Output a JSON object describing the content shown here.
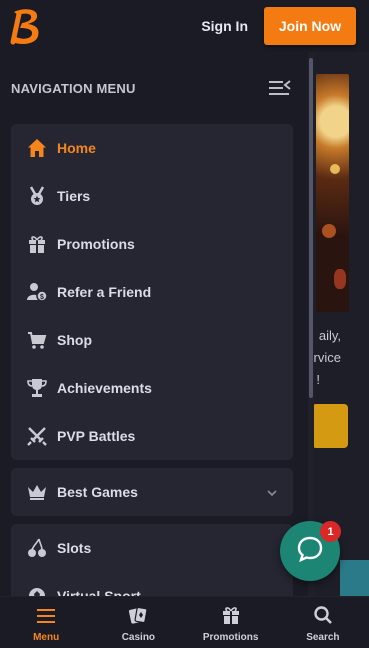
{
  "header": {
    "sign_in_label": "Sign In",
    "join_label": "Join Now",
    "accent_color": "#f47a12"
  },
  "nav": {
    "title": "NAVIGATION MENU",
    "items": [
      {
        "label": "Home",
        "icon": "home-icon",
        "active": true
      },
      {
        "label": "Tiers",
        "icon": "medal-icon"
      },
      {
        "label": "Promotions",
        "icon": "gift-icon"
      },
      {
        "label": "Refer a Friend",
        "icon": "refer-friend-icon"
      },
      {
        "label": "Shop",
        "icon": "cart-icon"
      },
      {
        "label": "Achievements",
        "icon": "trophy-icon"
      },
      {
        "label": "PVP Battles",
        "icon": "swords-icon"
      }
    ],
    "best_games_label": "Best Games",
    "categories": [
      {
        "label": "Slots",
        "icon": "cherries-icon"
      },
      {
        "label": "Virtual Sport",
        "icon": "virtual-sport-icon"
      }
    ]
  },
  "background_page": {
    "text_lines": [
      "aily,",
      "rvice",
      "!"
    ]
  },
  "bottom_nav": {
    "items": [
      {
        "label": "Menu",
        "icon": "menu-icon",
        "active": true
      },
      {
        "label": "Casino",
        "icon": "cards-icon"
      },
      {
        "label": "Promotions",
        "icon": "gift-icon"
      },
      {
        "label": "Search",
        "icon": "search-icon"
      }
    ]
  },
  "chat": {
    "badge_count": "1",
    "color": "#1c8573"
  }
}
